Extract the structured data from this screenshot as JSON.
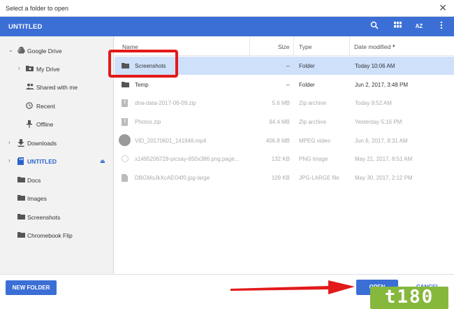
{
  "window": {
    "title": "Select a folder to open",
    "close_glyph": "✕"
  },
  "header": {
    "location": "UNTITLED",
    "sort_label": "AZ"
  },
  "sidebar": {
    "items": [
      {
        "label": "Google Drive",
        "icon": "google-drive-icon",
        "expanded": true
      },
      {
        "label": "My Drive",
        "icon": "folder-drive-icon"
      },
      {
        "label": "Shared with me",
        "icon": "people-icon"
      },
      {
        "label": "Recent",
        "icon": "clock-icon"
      },
      {
        "label": "Offline",
        "icon": "pin-icon"
      },
      {
        "label": "Downloads",
        "icon": "download-icon"
      },
      {
        "label": "UNTITLED",
        "icon": "usb-drive-icon",
        "selected": true
      },
      {
        "label": "Docs",
        "icon": "folder-icon"
      },
      {
        "label": "Images",
        "icon": "folder-icon"
      },
      {
        "label": "Screenshots",
        "icon": "folder-icon"
      },
      {
        "label": "Chromebook Flip",
        "icon": "folder-icon"
      }
    ]
  },
  "columns": {
    "name": "Name",
    "size": "Size",
    "type": "Type",
    "date": "Date modified"
  },
  "files": [
    {
      "name": "Screenshots",
      "size": "--",
      "type": "Folder",
      "date": "Today 10:06 AM",
      "kind": "folder",
      "selected": true,
      "dim": false
    },
    {
      "name": "Temp",
      "size": "--",
      "type": "Folder",
      "date": "Jun 2, 2017, 3:48 PM",
      "kind": "folder",
      "dim": false
    },
    {
      "name": "dna-data-2017-06-09.zip",
      "size": "5.6 MB",
      "type": "Zip archive",
      "date": "Today 9:52 AM",
      "kind": "archive",
      "dim": true
    },
    {
      "name": "Photos.zip",
      "size": "94.4 MB",
      "type": "Zip archive",
      "date": "Yesterday 5:16 PM",
      "kind": "archive",
      "dim": true
    },
    {
      "name": "VID_20170601_141946.mp4",
      "size": "406.8 MB",
      "type": "MPEG video",
      "date": "Jun 6, 2017, 8:31 AM",
      "kind": "video",
      "dim": true
    },
    {
      "name": "x1495206729-picsay-650x386.png.page...",
      "size": "132 KB",
      "type": "PNG image",
      "date": "May 21, 2017, 8:51 AM",
      "kind": "image",
      "dim": true
    },
    {
      "name": "DBGMoJkXcAEO4f0.jpg-large",
      "size": "109 KB",
      "type": "JPG-LARGE file",
      "date": "May 30, 2017, 2:12 PM",
      "kind": "file",
      "dim": true
    }
  ],
  "footer": {
    "new_folder": "NEW FOLDER",
    "open": "OPEN",
    "cancel": "CANCEL"
  },
  "watermark": "t180",
  "colors": {
    "accent": "#3b6fd6",
    "selection": "#cfe0fb",
    "annotation": "#e21a1a"
  }
}
